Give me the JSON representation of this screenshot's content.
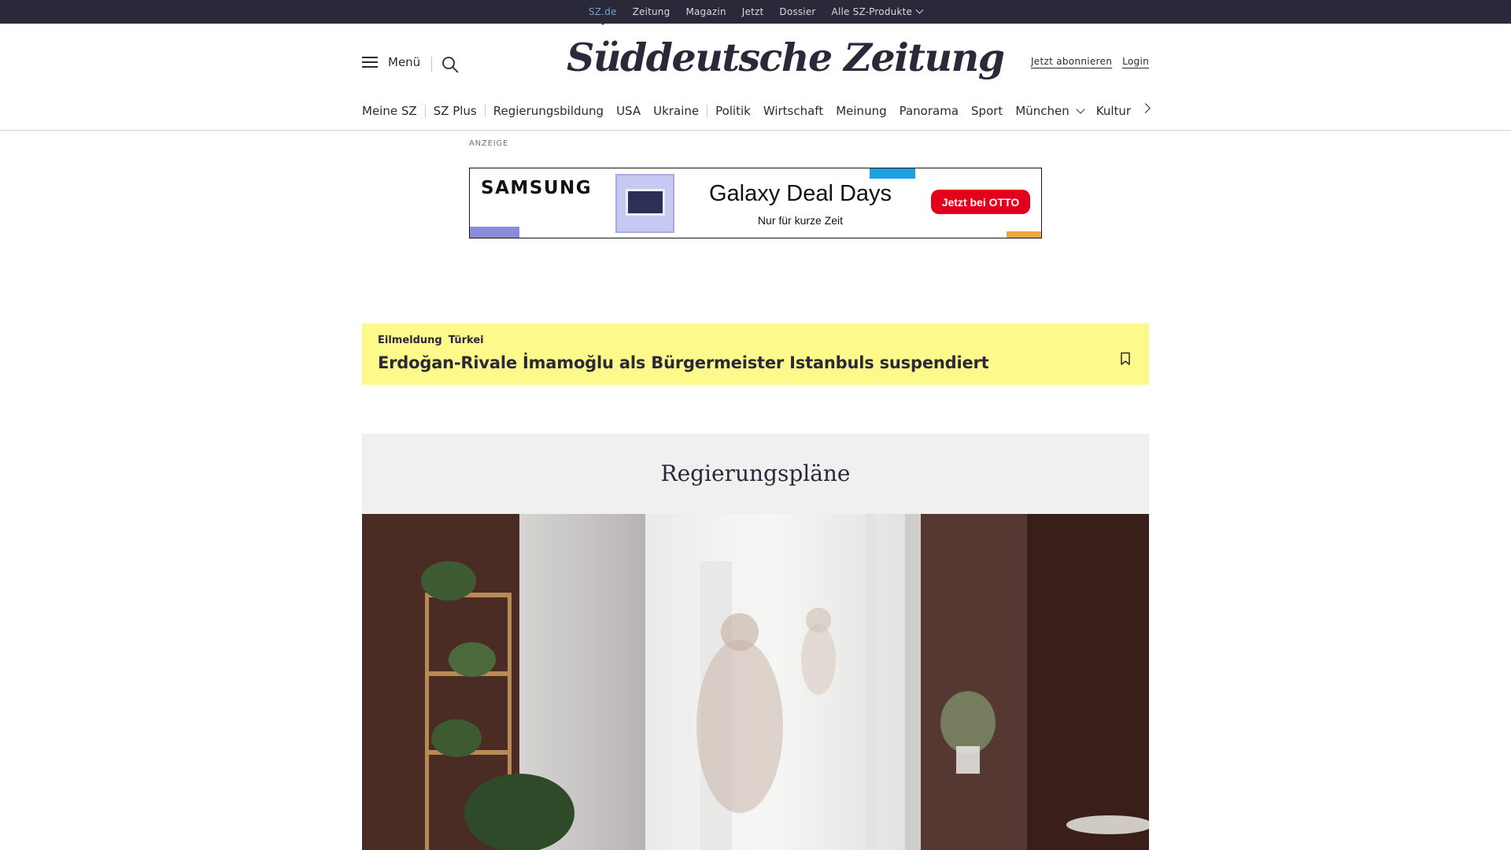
{
  "topbar": {
    "links": [
      "SZ.de",
      "Zeitung",
      "Magazin",
      "Jetzt",
      "Dossier",
      "Alle SZ-Produkte"
    ]
  },
  "header": {
    "menu_label": "Menü",
    "logo_text": "Süddeutsche Zeitung",
    "subscribe_label": "Jetzt abonnieren",
    "login_label": "Login"
  },
  "nav": {
    "items": [
      "Meine SZ",
      "SZ Plus",
      "Regierungsbildung",
      "USA",
      "Ukraine",
      "Politik",
      "Wirtschaft",
      "Meinung",
      "Panorama",
      "Sport",
      "München",
      "Kultur"
    ]
  },
  "ad": {
    "label": "ANZEIGE",
    "brand": "SAMSUNG",
    "headline": "Galaxy Deal Days",
    "subline": "Nur für kurze Zeit",
    "cta": "Jetzt bei OTTO"
  },
  "breaking": {
    "kicker_type": "Eilmeldung",
    "kicker_topic": "Türkei",
    "title": "Erdoğan-Rivale İmamoğlu als Bürgermeister Istanbuls suspendiert"
  },
  "section": {
    "title": "Regierungspläne"
  },
  "colors": {
    "topbar_bg": "#29293a",
    "active_link": "#71a5c9",
    "breaking_bg": "#fdf98a",
    "section_bg": "#f0f0f0",
    "ad_cta_red": "#e3001b"
  }
}
